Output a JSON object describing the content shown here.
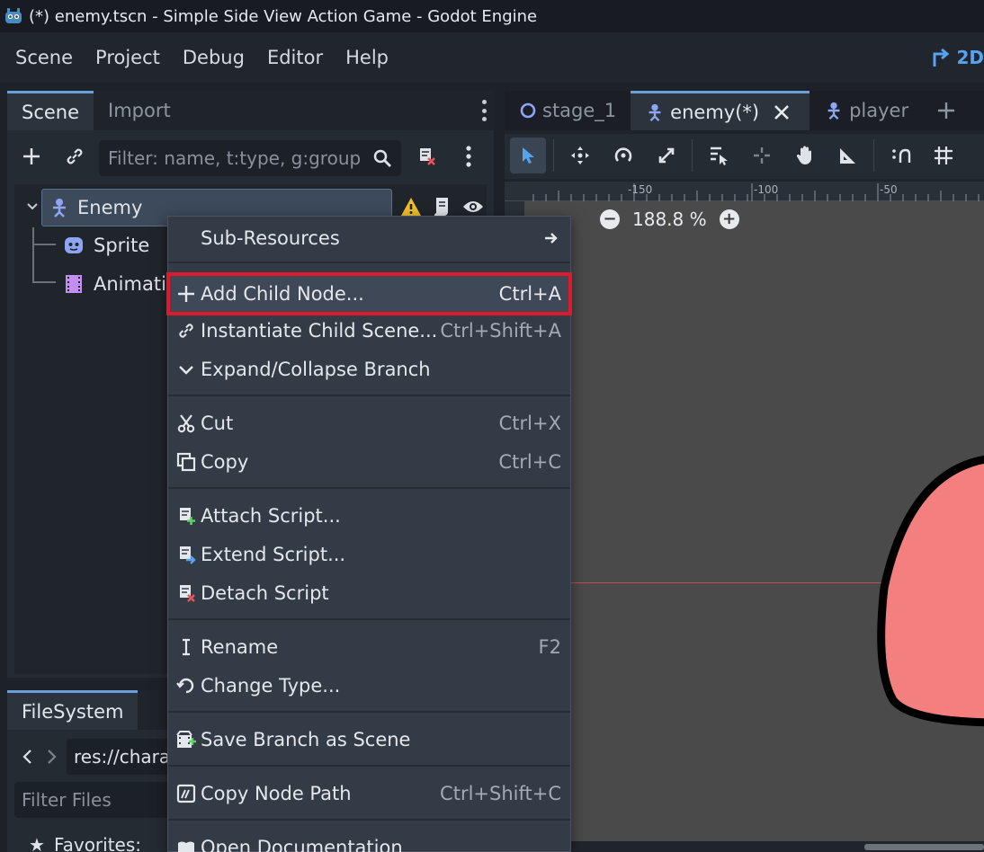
{
  "window": {
    "title": "(*) enemy.tscn - Simple Side View Action Game - Godot Engine"
  },
  "menubar": {
    "items": [
      "Scene",
      "Project",
      "Debug",
      "Editor",
      "Help"
    ],
    "mode_label": "2D"
  },
  "scene_dock": {
    "tabs": [
      "Scene",
      "Import"
    ],
    "filter_placeholder": "Filter: name, t:type, g:group",
    "tree": {
      "root": "Enemy",
      "children": [
        "Sprite",
        "Animatio"
      ]
    }
  },
  "editor": {
    "tabs": [
      "stage_1",
      "enemy(*)",
      "player"
    ],
    "zoom": "188.8 %",
    "ruler_labels": [
      "-150",
      "-100",
      "-50"
    ]
  },
  "filesystem": {
    "tab": "FileSystem",
    "path": "res://chara",
    "filter_placeholder": "Filter Files",
    "favorites": "Favorites:"
  },
  "context_menu": {
    "items": [
      {
        "label": "Sub-Resources",
        "shortcut": "",
        "icon": "arrow-right-icon"
      },
      {
        "label": "Add Child Node...",
        "shortcut": "Ctrl+A",
        "icon": "plus-icon",
        "highlighted": true
      },
      {
        "label": "Instantiate Child Scene...",
        "shortcut": "Ctrl+Shift+A",
        "icon": "link-icon"
      },
      {
        "label": "Expand/Collapse Branch",
        "shortcut": "",
        "icon": "chevron-down-icon"
      },
      {
        "label": "Cut",
        "shortcut": "Ctrl+X",
        "icon": "scissors-icon"
      },
      {
        "label": "Copy",
        "shortcut": "Ctrl+C",
        "icon": "copy-icon"
      },
      {
        "label": "Attach Script...",
        "shortcut": "",
        "icon": "script-add-icon"
      },
      {
        "label": "Extend Script...",
        "shortcut": "",
        "icon": "script-extend-icon"
      },
      {
        "label": "Detach Script",
        "shortcut": "",
        "icon": "script-remove-icon"
      },
      {
        "label": "Rename",
        "shortcut": "F2",
        "icon": "text-cursor-icon"
      },
      {
        "label": "Change Type...",
        "shortcut": "",
        "icon": "rotate-icon"
      },
      {
        "label": "Save Branch as Scene",
        "shortcut": "",
        "icon": "save-scene-icon"
      },
      {
        "label": "Copy Node Path",
        "shortcut": "Ctrl+Shift+C",
        "icon": "node-path-icon"
      },
      {
        "label": "Open Documentation",
        "shortcut": "",
        "icon": "help-icon"
      }
    ]
  },
  "colors": {
    "accent": "#56a3f0",
    "highlight_border": "#e0182c",
    "enemy_fill": "#f47f7f",
    "node_blue": "#8da5f3",
    "animation_purple": "#c38ef1",
    "warning": "#f0c02b"
  }
}
